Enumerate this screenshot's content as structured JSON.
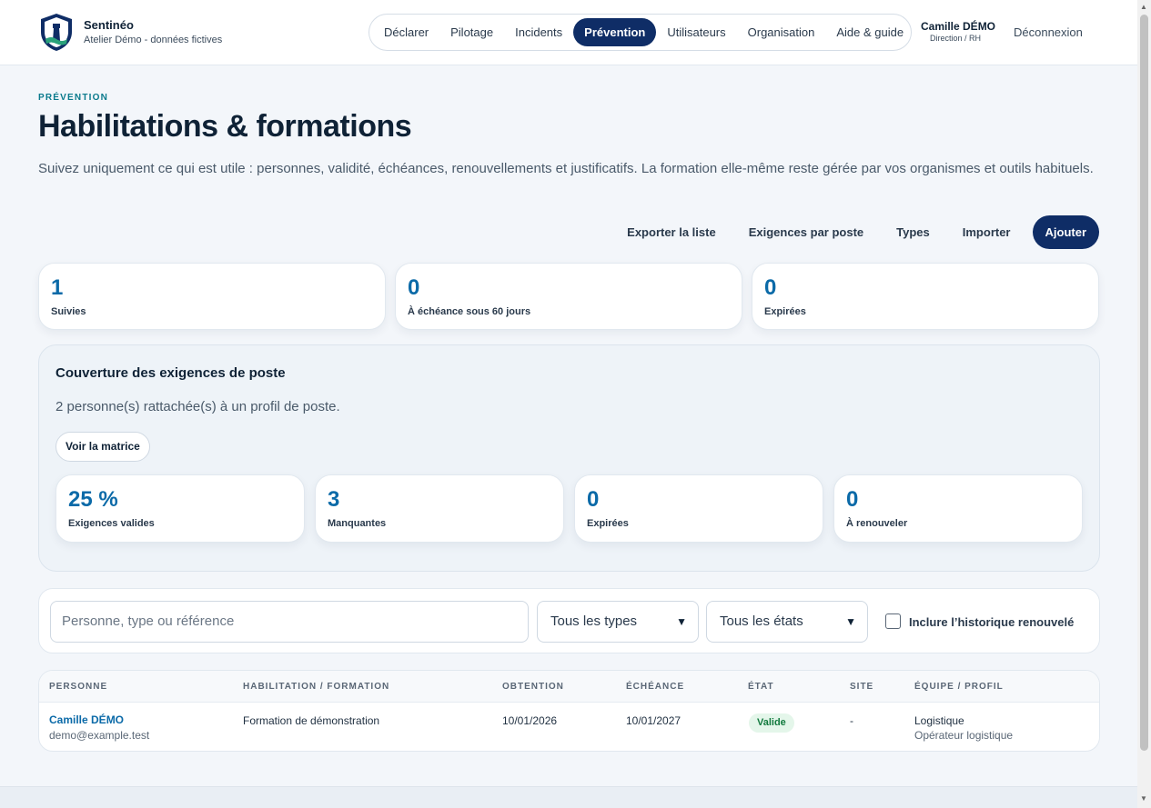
{
  "brand": {
    "name": "Sentinéo",
    "subtitle": "Atelier Démo - données fictives"
  },
  "nav": [
    "Déclarer",
    "Pilotage",
    "Incidents",
    "Prévention",
    "Utilisateurs",
    "Organisation",
    "Aide & guide"
  ],
  "nav_active": "Prévention",
  "user": {
    "name": "Camille DÉMO",
    "role": "Direction / RH",
    "logout": "Déconnexion"
  },
  "page": {
    "eyebrow": "PRÉVENTION",
    "title": "Habilitations & formations",
    "intro": "Suivez uniquement ce qui est utile : personnes, validité, échéances, renouvellements et justificatifs. La formation elle-même reste gérée par vos organismes et outils habituels."
  },
  "actions": [
    "Exporter la liste",
    "Exigences par poste",
    "Types",
    "Importer",
    "Ajouter"
  ],
  "stats": [
    {
      "value": "1",
      "label": "Suivies"
    },
    {
      "value": "0",
      "label": "À échéance sous 60 jours"
    },
    {
      "value": "0",
      "label": "Expirées"
    }
  ],
  "coverage": {
    "title": "Couverture des exigences de poste",
    "subtitle": "2 personne(s) rattachée(s) à un profil de poste.",
    "button": "Voir la matrice",
    "stats": [
      {
        "value": "25 %",
        "label": "Exigences valides"
      },
      {
        "value": "3",
        "label": "Manquantes"
      },
      {
        "value": "0",
        "label": "Expirées"
      },
      {
        "value": "0",
        "label": "À renouveler"
      }
    ]
  },
  "filters": {
    "search_placeholder": "Personne, type ou référence",
    "type_select": "Tous les types",
    "state_select": "Tous les états",
    "history_label": "Inclure l’historique renouvelé"
  },
  "table": {
    "headers": [
      "PERSONNE",
      "HABILITATION / FORMATION",
      "OBTENTION",
      "ÉCHÉANCE",
      "ÉTAT",
      "SITE",
      "ÉQUIPE / PROFIL"
    ],
    "rows": [
      {
        "person": "Camille DÉMO",
        "email": "demo@example.test",
        "training": "Formation de démonstration",
        "obtained": "10/01/2026",
        "due": "10/01/2027",
        "state": "Valide",
        "site": "-",
        "team": "Logistique",
        "profile": "Opérateur logistique"
      }
    ]
  },
  "colors": {
    "primary": "#0f2d66",
    "accent": "#0b6aa8",
    "eyebrow": "#0a7a8c",
    "valid_bg": "#e4f6ea",
    "valid_fg": "#127a3e"
  },
  "icons": {
    "logo": "lighthouse-shield-icon",
    "select": "chevron-down-icon",
    "checkbox": "checkbox-icon"
  }
}
